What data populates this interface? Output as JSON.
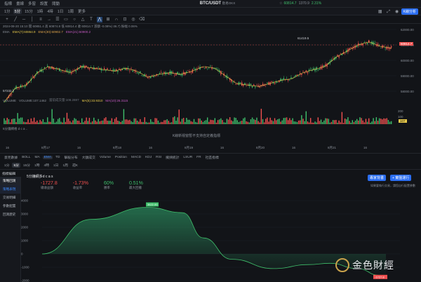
{
  "topbar": {
    "items": [
      "指標",
      "畫線",
      "多窗",
      "設置",
      "閱動"
    ],
    "intervals": [
      "1分",
      "5分",
      "15分",
      "1時",
      "4時",
      "1日",
      "1周",
      "更多"
    ],
    "active_interval": "5分"
  },
  "title": {
    "pair": "BTC/USDT",
    "exchange": "歐易OKX",
    "price": "60814.7",
    "change_abs": "1370.9",
    "change_pct": "2.31%"
  },
  "toolbar": {
    "kline_analysis": "K線分析"
  },
  "legend": {
    "line1": "2024-08-20 15:10 開 60851.4 高 60874.8 低 60814.4 收 60814.7 漲額 -0.08%(-36.7) 振幅 0.06%",
    "line2_prefix": "EMA",
    "ema7": "EMA(7):60864.9",
    "ema30": "EMA(30):60902.7",
    "ema21": "EMA(21):60900.2"
  },
  "price_axis": {
    "ticks": [
      "62000.00",
      "61000.00",
      "60000.00",
      "59000.00",
      "58000.00"
    ],
    "current": "60814.7",
    "max_label": "61419.5",
    "min_label": "57232.7"
  },
  "volume": {
    "label": "VOLUME",
    "value": "VOLUME:107.1462",
    "ma": "當前成交量:108.2887",
    "ma5": "MA(5):33.9310",
    "ma10": "MA(10):26.3115",
    "ticks": [
      "200",
      "100"
    ],
    "current": "107"
  },
  "notice": "K線新視窗暫不支持自定義指標",
  "strategy_label": "5分鐘網格 d c a ..",
  "time_axis": [
    "16",
    "8月17",
    "16",
    "8月18",
    "16",
    "8月19",
    "16",
    "8月20",
    "16",
    "8月21",
    "16"
  ],
  "ind_tabs": [
    "意見數據",
    "BOLL",
    "MA",
    "EMA",
    "TD",
    "擊殺分布",
    "大額成交",
    "Volume",
    "Position",
    "MACD",
    "KDJ",
    "RSI",
    "擁擠統計",
    "LSUR",
    "FR",
    "社區指標"
  ],
  "ind_active": "EMA",
  "sub_intervals": [
    "1分",
    "5分",
    "15分",
    "1時",
    "4時",
    "1日",
    "1周",
    "週K"
  ],
  "sidebar": {
    "header": "指標編輯",
    "group": "策略回測",
    "items": [
      "策略表現",
      "交易明細",
      "參數配置",
      "回測歷史"
    ],
    "active": "策略表現"
  },
  "backtest": {
    "name": "5分鐘網多d c a s",
    "btn_publish": "專家背書",
    "btn_add": "+ 實盤運行",
    "stats": [
      {
        "value": "-1727.8",
        "label": "總收益額"
      },
      {
        "value": "-1.73%",
        "label": "收益率"
      },
      {
        "value": "60%",
        "label": "勝率"
      },
      {
        "value": "0.51%",
        "label": "最大回撤"
      }
    ],
    "note": "如果要執行交易，請您自行配置參數",
    "yticks": [
      "4000",
      "3000",
      "2000",
      "1000",
      "0",
      "-1000",
      "-2000"
    ],
    "peak_label": "3622.00",
    "end_label": "-1727.8"
  },
  "watermark": "金色財經"
}
